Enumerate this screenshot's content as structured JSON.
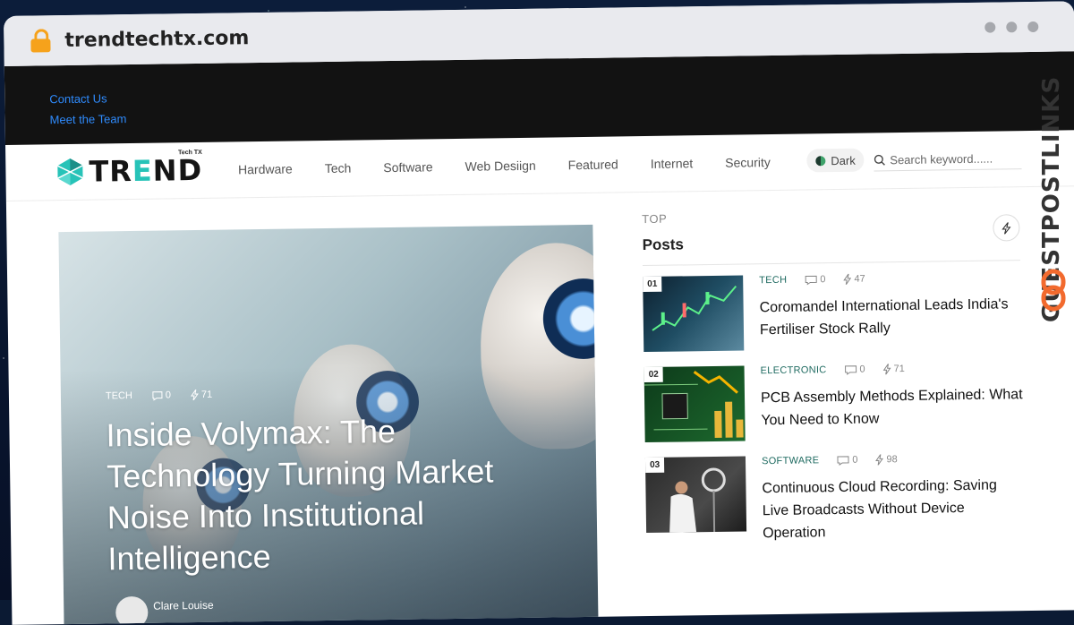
{
  "browser": {
    "url": "trendtechtx.com"
  },
  "topbar": {
    "links": [
      "Contact Us",
      "Meet the Team"
    ]
  },
  "logo": {
    "word_start": "TR",
    "word_accent": "E",
    "word_end": "ND",
    "tagline": "Tech TX"
  },
  "nav": {
    "items": [
      "Hardware",
      "Tech",
      "Software",
      "Web Desiign",
      "Featured",
      "Internet",
      "Security"
    ]
  },
  "dark_toggle": {
    "label": "Dark"
  },
  "search": {
    "placeholder": "Search keyword......"
  },
  "hero": {
    "category": "TECH",
    "comments": "0",
    "views": "71",
    "title": "Inside Volymax: The Technology Turning Market Noise Into Institutional Intelligence",
    "author": "Clare Louise"
  },
  "sidebar": {
    "top_label": "TOP",
    "heading": "Posts",
    "posts": [
      {
        "num": "01",
        "category": "TECH",
        "comments": "0",
        "views": "47",
        "title": "Coromandel International Leads India's Fertiliser Stock Rally"
      },
      {
        "num": "02",
        "category": "ELECTRONIC",
        "comments": "0",
        "views": "71",
        "title": "PCB Assembly Methods Explained: What You Need to Know"
      },
      {
        "num": "03",
        "category": "SOFTWARE",
        "comments": "0",
        "views": "98",
        "title": "Continuous Cloud Recording: Saving Live Broadcasts Without Device Operation"
      }
    ]
  },
  "watermark": {
    "text": "GUESTPOSTLINKS"
  },
  "colors": {
    "accent": "#27c3b8",
    "link": "#2f8cff",
    "lock": "#f6a21b",
    "brand_orange": "#f26a2e"
  }
}
